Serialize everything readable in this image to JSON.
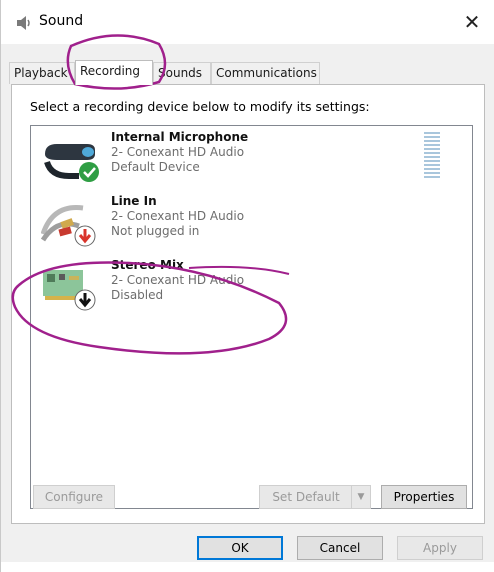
{
  "window": {
    "title": "Sound",
    "close_glyph": "✕",
    "icon": "speaker-icon"
  },
  "tabs": [
    {
      "label": "Playback",
      "active": false
    },
    {
      "label": "Recording",
      "active": true
    },
    {
      "label": "Sounds",
      "active": false
    },
    {
      "label": "Communications",
      "active": false
    }
  ],
  "instruction": "Select a recording device below to modify its settings:",
  "devices": [
    {
      "name": "Internal Microphone",
      "line2": "2- Conexant HD Audio",
      "line3": "Default Device",
      "icon": "microphone-icon",
      "status_icon": "check-badge-icon",
      "status_color": "#2f9e44"
    },
    {
      "name": "Line In",
      "line2": "2- Conexant HD Audio",
      "line3": "Not plugged in",
      "icon": "audio-cable-icon",
      "status_icon": "down-arrow-red-badge-icon",
      "status_color": "#d9342b"
    },
    {
      "name": "Stereo Mix",
      "line2": "2- Conexant HD Audio",
      "line3": "Disabled",
      "icon": "sound-card-icon",
      "status_icon": "down-arrow-black-badge-icon",
      "status_color": "#111111"
    }
  ],
  "buttons": {
    "configure": "Configure",
    "set_default": "Set Default",
    "properties": "Properties",
    "ok": "OK",
    "cancel": "Cancel",
    "apply": "Apply"
  },
  "colors": {
    "annotation": "#a0208c",
    "accent": "#0078d7"
  }
}
